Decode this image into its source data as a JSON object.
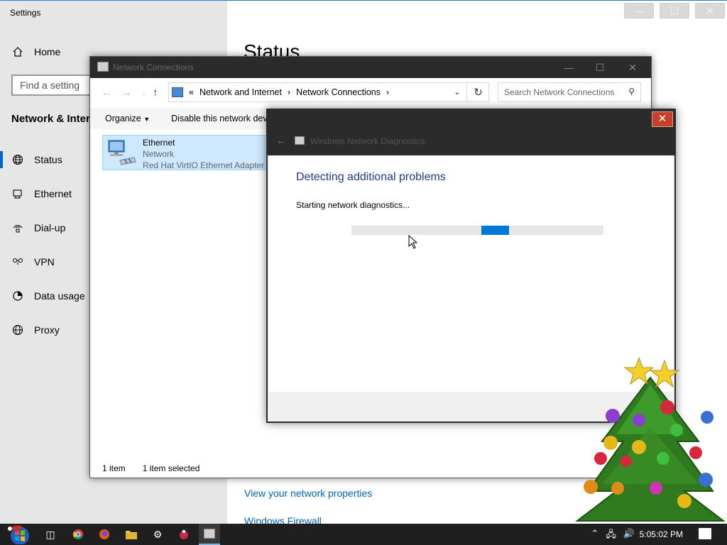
{
  "settings": {
    "title": "Settings",
    "home": "Home",
    "search_placeholder": "Find a setting",
    "section": "Network & Internet",
    "heading": "Status",
    "nav": [
      {
        "label": "Status",
        "icon": "globe-icon"
      },
      {
        "label": "Ethernet",
        "icon": "ethernet-icon"
      },
      {
        "label": "Dial-up",
        "icon": "dialup-icon"
      },
      {
        "label": "VPN",
        "icon": "vpn-icon"
      },
      {
        "label": "Data usage",
        "icon": "data-usage-icon"
      },
      {
        "label": "Proxy",
        "icon": "globe-icon"
      }
    ],
    "links": {
      "view_props": "View your network properties",
      "firewall": "Windows Firewall"
    }
  },
  "netconn": {
    "title": "Network Connections",
    "breadcrumb": [
      "Network and Internet",
      "Network Connections"
    ],
    "search_placeholder": "Search Network Connections",
    "toolbar": {
      "organize": "Organize",
      "disable": "Disable this network device"
    },
    "item": {
      "name": "Ethernet",
      "network": "Network",
      "adapter": "Red Hat VirtIO Ethernet Adapter"
    },
    "status": {
      "count": "1 item",
      "selected": "1 item selected"
    }
  },
  "diag": {
    "title": "Windows Network Diagnostics",
    "heading": "Detecting additional problems",
    "status": "Starting network diagnostics...",
    "progress_fraction": 0.58
  },
  "taskbar": {
    "time": "5:05:02 PM"
  }
}
